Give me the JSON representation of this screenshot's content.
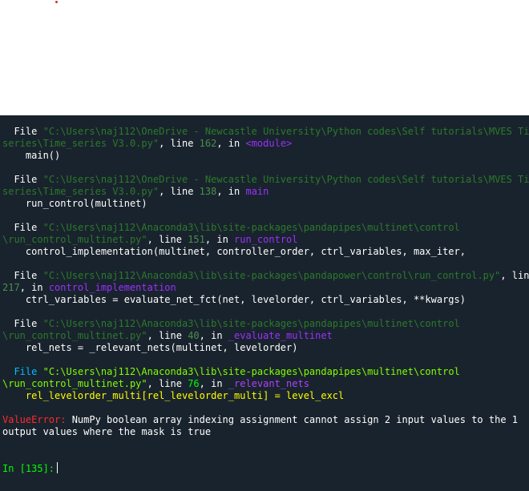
{
  "traceback": {
    "frames": [
      {
        "file_kw": "File",
        "path_part1": "\"C:\\Users\\naj112\\OneDrive - Newcastle University\\Python codes\\Self tutorials\\MVES Time",
        "path_part2": "series\\Time_series V3.0.py\"",
        "line_kw": ", line ",
        "line_no": "162",
        "in_kw": ", in ",
        "func": "<module>",
        "code": "main()"
      },
      {
        "file_kw": "File",
        "path_part1": "\"C:\\Users\\naj112\\OneDrive - Newcastle University\\Python codes\\Self tutorials\\MVES Time",
        "path_part2": "series\\Time_series V3.0.py\"",
        "line_kw": ", line ",
        "line_no": "138",
        "in_kw": ", in ",
        "func": "main",
        "code": "run_control(multinet)"
      },
      {
        "file_kw": "File",
        "path_part1": "\"C:\\Users\\naj112\\Anaconda3\\lib\\site-packages\\pandapipes\\multinet\\control",
        "path_part2": "\\run_control_multinet.py\"",
        "line_kw": ", line ",
        "line_no": "151",
        "in_kw": ", in ",
        "func": "run_control",
        "code": "control_implementation(multinet, controller_order, ctrl_variables, max_iter,"
      },
      {
        "file_kw": "File",
        "path_part1": "\"C:\\Users\\naj112\\Anaconda3\\lib\\site-packages\\pandapower\\control\\run_control.py\"",
        "path_tail": ", line",
        "path_part2": "217",
        "in_kw": ", in ",
        "func": "control_implementation",
        "code": "ctrl_variables = evaluate_net_fct(net, levelorder, ctrl_variables, **kwargs)"
      },
      {
        "file_kw": "File",
        "path_part1": "\"C:\\Users\\naj112\\Anaconda3\\lib\\site-packages\\pandapipes\\multinet\\control",
        "path_part2": "\\run_control_multinet.py\"",
        "line_kw": ", line ",
        "line_no": "40",
        "in_kw": ", in ",
        "func": "_evaluate_multinet",
        "code": "rel_nets = _relevant_nets(multinet, levelorder)"
      },
      {
        "file_kw": "File",
        "path_part1": "\"C:\\Users\\naj112\\Anaconda3\\lib\\site-packages\\pandapipes\\multinet\\control",
        "path_part2": "\\run_control_multinet.py\"",
        "line_kw": ", line ",
        "line_no": "76",
        "in_kw": ", in ",
        "func": "_relevant_nets",
        "code": "rel_levelorder_multi[rel_levelorder_multi] = level_excl"
      }
    ],
    "error": {
      "label": "ValueError:",
      "message_line1": " NumPy boolean array indexing assignment cannot assign 2 input values to the 1",
      "message_line2": "output values where the mask is true"
    }
  },
  "prompt": {
    "text": "In [135]:"
  },
  "colors": {
    "console_bg": "#19232d",
    "path_dim": "#2b7a2b",
    "path_bright": "#7fff00",
    "func": "#9b30ff",
    "error": "#ff2a2a",
    "prompt": "#00ff00"
  }
}
